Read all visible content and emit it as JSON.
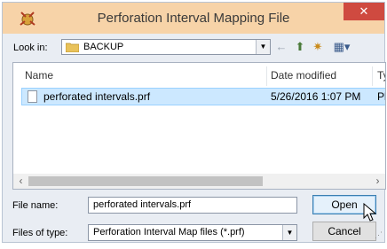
{
  "window": {
    "title": "Perforation Interval Mapping File",
    "close_glyph": "✕"
  },
  "toolbar": {
    "look_in_label": "Look in:",
    "look_in_value": "BACKUP",
    "back_glyph": "←",
    "up_glyph": "⬆",
    "new_folder_glyph": "✷",
    "view_glyph": "▦▾"
  },
  "file_list": {
    "columns": [
      "Name",
      "Date modified",
      "Ty"
    ],
    "rows": [
      {
        "name": "perforated intervals.prf",
        "date": "5/26/2016 1:07 PM",
        "type": "Pl"
      }
    ],
    "scroll_left": "‹",
    "scroll_right": "›"
  },
  "form": {
    "file_name_label": "File name:",
    "file_name_value": "perforated intervals.prf",
    "files_of_type_label": "Files of type:",
    "files_of_type_value": "Perforation Interval Map files (*.prf)",
    "open_label": "Open",
    "cancel_label": "Cancel"
  },
  "colors": {
    "titlebar": "#f7d3a8",
    "selection": "#cce8ff",
    "close": "#cf4a40"
  }
}
